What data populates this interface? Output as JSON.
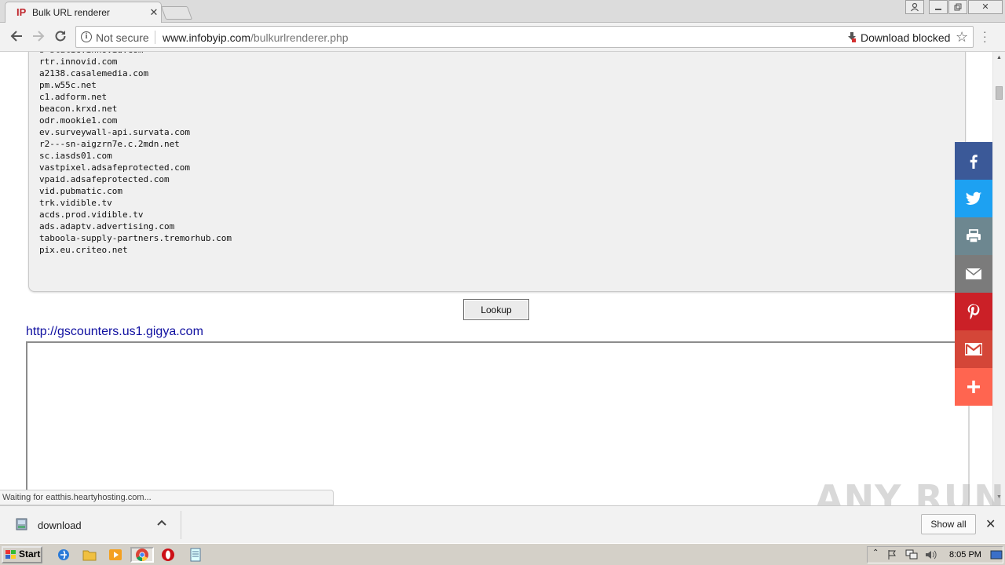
{
  "browser": {
    "tab_title": "Bulk URL renderer",
    "favicon_text": "IP",
    "omnibox": {
      "security_label": "Not secure",
      "url_host": "www.infobyip.com",
      "url_path": "/bulkurlrenderer.php",
      "download_blocked": "Download blocked"
    }
  },
  "page": {
    "url_list": [
      "s-static.innovid.com",
      "rtr.innovid.com",
      "a2138.casalemedia.com",
      "pm.w55c.net",
      "c1.adform.net",
      "beacon.krxd.net",
      "odr.mookie1.com",
      "ev.surveywall-api.survata.com",
      "r2---sn-aigzrn7e.c.2mdn.net",
      "sc.iasds01.com",
      "vastpixel.adsafeprotected.com",
      "vpaid.adsafeprotected.com",
      "vid.pubmatic.com",
      "trk.vidible.tv",
      "acds.prod.vidible.tv",
      "ads.adaptv.advertising.com",
      "taboola-supply-partners.tremorhub.com",
      "pix.eu.criteo.net"
    ],
    "lookup_label": "Lookup",
    "result_url": "http://gscounters.us1.gigya.com"
  },
  "share_bar": [
    {
      "name": "facebook",
      "icon": "facebook-icon",
      "color": "#3b5998"
    },
    {
      "name": "twitter",
      "icon": "twitter-icon",
      "color": "#1da1f2"
    },
    {
      "name": "print",
      "icon": "print-icon",
      "color": "#6d8790"
    },
    {
      "name": "email",
      "icon": "email-icon",
      "color": "#7b7b7b"
    },
    {
      "name": "pinterest",
      "icon": "pinterest-icon",
      "color": "#cb2027"
    },
    {
      "name": "gmail",
      "icon": "gmail-icon",
      "color": "#d44638"
    },
    {
      "name": "more",
      "icon": "plus-icon",
      "color": "#ff6550"
    }
  ],
  "status_text": "Waiting for eatthis.heartyhosting.com...",
  "watermark": "ANY RUN",
  "download_shelf": {
    "file_name": "download",
    "show_all_label": "Show all"
  },
  "taskbar": {
    "start_label": "Start",
    "clock": "8:05 PM"
  }
}
